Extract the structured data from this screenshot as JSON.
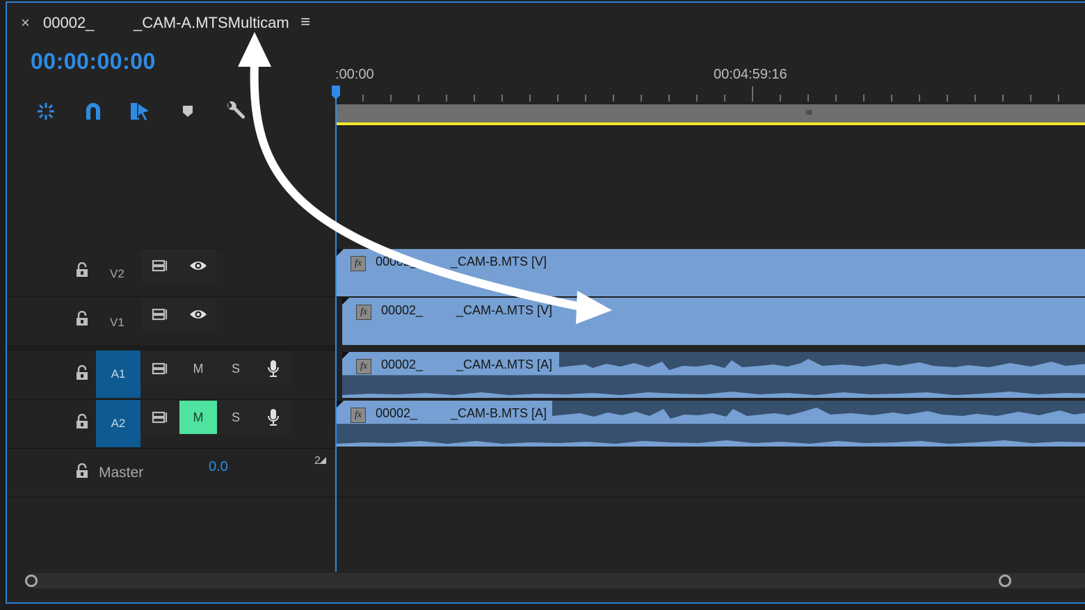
{
  "tab": {
    "close_glyph": "×",
    "name_part1": "00002_",
    "name_part2": "_CAM-A.MTSMulticam",
    "menu_glyph": "≡"
  },
  "playhead_time": "00:00:00:00",
  "tools": [
    "insert-overwrite-icon",
    "snap-icon",
    "linked-selection-icon",
    "add-marker-icon",
    "wrench-icon"
  ],
  "ruler": {
    "start": ":00:00",
    "mid": "00:04:59:16"
  },
  "tracks": {
    "v2": {
      "label": "V2"
    },
    "v1": {
      "label": "V1"
    },
    "a1": {
      "label": "A1",
      "m": "M",
      "s": "S"
    },
    "a2": {
      "label": "A2",
      "m": "M",
      "s": "S"
    },
    "master": {
      "label": "Master",
      "value": "0.0",
      "mode_glyph": "2"
    }
  },
  "clips": {
    "v2": {
      "fx": "fx",
      "name1": "00002_",
      "name2": "_CAM-B.MTS [V]"
    },
    "v1": {
      "fx": "fx",
      "name1": "00002_",
      "name2": "_CAM-A.MTS [V]"
    },
    "a1": {
      "fx": "fx",
      "name1": "00002_",
      "name2": "_CAM-A.MTS [A]"
    },
    "a2": {
      "fx": "fx",
      "name1": "00002_",
      "name2": "_CAM-B.MTS [A]"
    }
  },
  "colors": {
    "accent_blue": "#2d8ce6",
    "clip_blue": "#76a0d3",
    "audio_dark": "#37506e",
    "mute_active": "#4fe3a0",
    "work_area_yellow": "#f5e62a",
    "track_target": "#0e5a92"
  }
}
